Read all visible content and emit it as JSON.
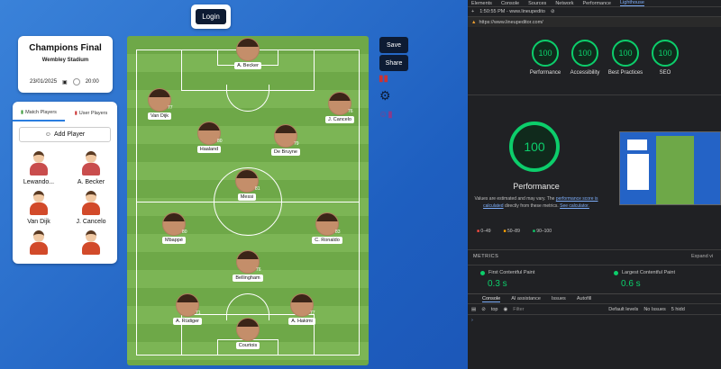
{
  "app": {
    "login": "Login",
    "save": "Save",
    "share": "Share"
  },
  "match": {
    "title": "Champions Final",
    "stadium": "Wembley Stadium",
    "date": "23/01/2025",
    "time": "20:00"
  },
  "panel": {
    "tab1": "Match Players",
    "tab2": "User Players",
    "add": "Add Player",
    "players": [
      {
        "name": "Lewando...",
        "color": "#c94d4d"
      },
      {
        "name": "A. Becker",
        "color": "#c94d4d"
      },
      {
        "name": "Van Dijk",
        "color": "#d24a2a"
      },
      {
        "name": "J. Cancelo",
        "color": "#d24a2a"
      },
      {
        "name": "",
        "color": "#d24a2a"
      },
      {
        "name": "",
        "color": "#d24a2a"
      }
    ]
  },
  "pitch": {
    "players": [
      {
        "name": "A. Becker",
        "rating": "",
        "pos": "gk"
      },
      {
        "name": "Van Dijk",
        "rating": "77",
        "pos": "lb"
      },
      {
        "name": "J. Cancelo",
        "rating": "76",
        "pos": "rb"
      },
      {
        "name": "Haaland",
        "rating": "80",
        "pos": "lm"
      },
      {
        "name": "De Bruyne",
        "rating": "79",
        "pos": "rm"
      },
      {
        "name": "Messi",
        "rating": "81",
        "pos": "cm"
      },
      {
        "name": "Mbappé",
        "rating": "80",
        "pos": "lw"
      },
      {
        "name": "C. Ronaldo",
        "rating": "83",
        "pos": "rw"
      },
      {
        "name": "Bellingham",
        "rating": "76",
        "pos": "cam"
      },
      {
        "name": "A. Rüdiger",
        "rating": "71",
        "pos": "ls"
      },
      {
        "name": "A. Hakimi",
        "rating": "77",
        "pos": "rs"
      },
      {
        "name": "Courtois",
        "rating": "",
        "pos": "gk2"
      }
    ]
  },
  "devtools": {
    "tabs": [
      "Elements",
      "Console",
      "Sources",
      "Network",
      "Performance",
      "Lighthouse"
    ],
    "active_tab": "Lighthouse",
    "time": "1:50:55 PM - www.lineupedito",
    "url": "https://www.lineupeditor.com/",
    "scores": [
      {
        "label": "Performance",
        "value": "100"
      },
      {
        "label": "Accessibility",
        "value": "100"
      },
      {
        "label": "Best Practices",
        "value": "100"
      },
      {
        "label": "SEO",
        "value": "100"
      }
    ],
    "perf_score": "100",
    "perf_title": "Performance",
    "perf_note_1": "Values are estimated and may vary. The",
    "perf_note_link": "performance score is calculated",
    "perf_note_2": "directly from these metrics.",
    "perf_note_calc": "See calculator.",
    "legend": [
      {
        "range": "0–49",
        "color": "#ff4e42"
      },
      {
        "range": "50–89",
        "color": "#ffa400"
      },
      {
        "range": "90–100",
        "color": "#0cce6b"
      }
    ],
    "metrics_label": "METRICS",
    "expand": "Expand vi",
    "fcp_label": "First Contentful Paint",
    "fcp": "0.3 s",
    "lcp_label": "Largest Contentful Paint",
    "lcp": "0.6 s",
    "console_tabs": [
      "Console",
      "AI assistance",
      "Issues",
      "Autofill"
    ],
    "console_top": "top",
    "filter": "Filter",
    "levels": "Default levels",
    "issues": "No Issues",
    "hidden": "5 hidd"
  }
}
